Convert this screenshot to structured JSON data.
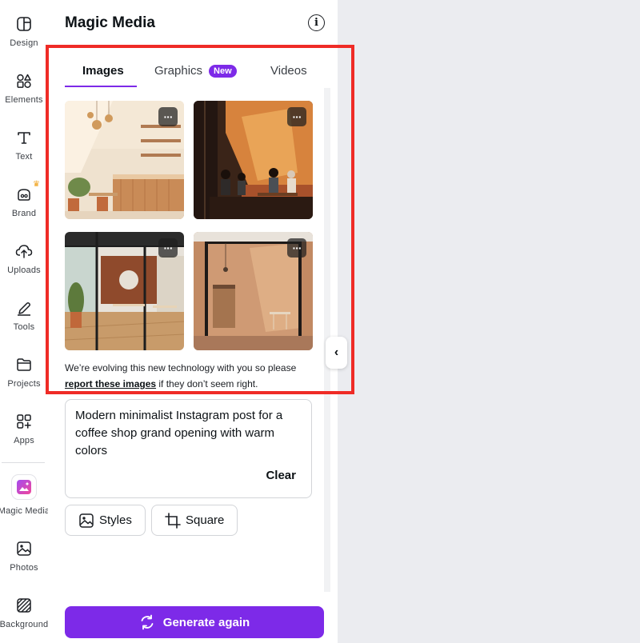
{
  "colors": {
    "accent": "#7d2ae8",
    "highlight_border": "#ef2b26",
    "canvas_bg": "#ebecf0"
  },
  "sidebar": {
    "items": [
      {
        "label": "Design",
        "icon": "layout-icon"
      },
      {
        "label": "Elements",
        "icon": "shapes-icon"
      },
      {
        "label": "Text",
        "icon": "text-icon"
      },
      {
        "label": "Brand",
        "icon": "brand-icon"
      },
      {
        "label": "Uploads",
        "icon": "cloud-upload-icon"
      },
      {
        "label": "Tools",
        "icon": "pen-tool-icon"
      },
      {
        "label": "Projects",
        "icon": "folder-icon"
      },
      {
        "label": "Apps",
        "icon": "apps-grid-icon"
      },
      {
        "label": "Magic Media",
        "icon": "magic-media-icon"
      },
      {
        "label": "Photos",
        "icon": "photo-icon"
      },
      {
        "label": "Background",
        "icon": "background-icon"
      }
    ]
  },
  "panel": {
    "title": "Magic Media",
    "tabs": [
      {
        "label": "Images",
        "active": true
      },
      {
        "label": "Graphics",
        "badge": "New"
      },
      {
        "label": "Videos"
      }
    ],
    "results": [
      {
        "kind": "interior-sunlit-cafe",
        "more": "···"
      },
      {
        "kind": "interior-orange-cafe-people",
        "more": "···"
      },
      {
        "kind": "interior-glass-doors-cafe",
        "more": "···"
      },
      {
        "kind": "interior-entry-doors",
        "more": "···"
      }
    ],
    "disclaimer": {
      "text": "We’re evolving this new technology with you so please",
      "link": "report these images",
      "suffix": " if they don’t seem right."
    },
    "prompt": {
      "value": "Modern minimalist Instagram post for a coffee shop grand opening with warm colors",
      "clear_label": "Clear"
    },
    "options": {
      "styles_label": "Styles",
      "aspect_label": "Square"
    },
    "generate_label": "Generate again",
    "collapse_glyph": "‹"
  }
}
